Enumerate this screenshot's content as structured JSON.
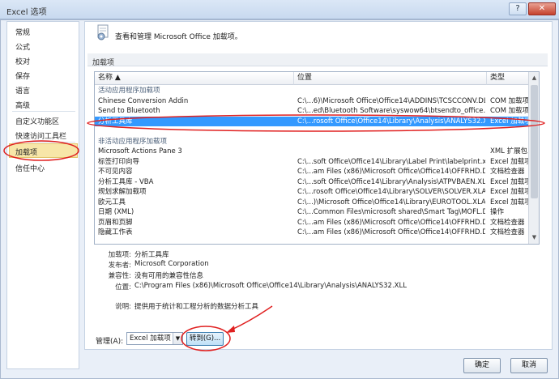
{
  "window": {
    "title": "Excel 选项",
    "help_label": "?",
    "close_label": "✕"
  },
  "sidebar": {
    "items": [
      {
        "label": "常规"
      },
      {
        "label": "公式"
      },
      {
        "label": "校对"
      },
      {
        "label": "保存"
      },
      {
        "label": "语言"
      },
      {
        "label": "高级"
      },
      {
        "label": "自定义功能区"
      },
      {
        "label": "快速访问工具栏"
      },
      {
        "label": "加载项"
      },
      {
        "label": "信任中心"
      }
    ],
    "active_index": 8
  },
  "header": {
    "icon": "gear-icon",
    "text": "查看和管理 Microsoft Office 加载项。"
  },
  "addins": {
    "section_title": "加载项",
    "columns": {
      "name": "名称 ▲",
      "location": "位置",
      "type": "类型"
    },
    "rows": [
      {
        "kind": "group",
        "name": "活动应用程序加载项",
        "location": "",
        "type": ""
      },
      {
        "kind": "item",
        "name": "Chinese Conversion Addin",
        "location": "C:\\...6)\\Microsoft Office\\Office14\\ADDINS\\TCSCCONV.DLL",
        "type": "COM 加载项"
      },
      {
        "kind": "item",
        "name": "Send to Bluetooth",
        "location": "C:\\...ed\\Bluetooth Software\\syswow64\\btsendto_office.dll",
        "type": "COM 加载项"
      },
      {
        "kind": "selected",
        "name": "分析工具库",
        "location": "C:\\...rosoft Office\\Office14\\Library\\Analysis\\ANALYS32.XLL",
        "type": "Excel 加载项"
      },
      {
        "kind": "item",
        "name": "",
        "location": "",
        "type": ""
      },
      {
        "kind": "group",
        "name": "非活动应用程序加载项",
        "location": "",
        "type": ""
      },
      {
        "kind": "item",
        "name": "Microsoft Actions Pane 3",
        "location": "",
        "type": "XML 扩展包"
      },
      {
        "kind": "item",
        "name": "标签打印向导",
        "location": "C:\\...soft Office\\Office14\\Library\\Label Print\\labelprint.xlam",
        "type": "Excel 加载项"
      },
      {
        "kind": "item",
        "name": "不可见内容",
        "location": "C:\\...am Files (x86)\\Microsoft Office\\Office14\\OFFRHD.DLL",
        "type": "文档检查器"
      },
      {
        "kind": "item",
        "name": "分析工具库 - VBA",
        "location": "C:\\...soft Office\\Office14\\Library\\Analysis\\ATPVBAEN.XLAM",
        "type": "Excel 加载项"
      },
      {
        "kind": "item",
        "name": "规划求解加载项",
        "location": "C:\\...rosoft Office\\Office14\\Library\\SOLVER\\SOLVER.XLAM",
        "type": "Excel 加载项"
      },
      {
        "kind": "item",
        "name": "欧元工具",
        "location": "C:\\...)\\Microsoft Office\\Office14\\Library\\EUROTOOL.XLAM",
        "type": "Excel 加载项"
      },
      {
        "kind": "item",
        "name": "日期 (XML)",
        "location": "C:\\...Common Files\\microsoft shared\\Smart Tag\\MOFL.DLL",
        "type": "操作"
      },
      {
        "kind": "item",
        "name": "页眉和页脚",
        "location": "C:\\...am Files (x86)\\Microsoft Office\\Office14\\OFFRHD.DLL",
        "type": "文档检查器"
      },
      {
        "kind": "item",
        "name": "隐藏工作表",
        "location": "C:\\...am Files (x86)\\Microsoft Office\\Office14\\OFFRHD.DLL",
        "type": "文档检查器"
      }
    ]
  },
  "details": {
    "addin": {
      "label": "加载项:",
      "value": "分析工具库"
    },
    "publisher": {
      "label": "发布者:",
      "value": "Microsoft Corporation"
    },
    "compat": {
      "label": "兼容性:",
      "value": "没有可用的兼容性信息"
    },
    "location": {
      "label": "位置:",
      "value": "C:\\Program Files (x86)\\Microsoft Office\\Office14\\Library\\Analysis\\ANALYS32.XLL"
    },
    "description": {
      "label": "说明:",
      "value": "提供用于统计和工程分析的数据分析工具"
    }
  },
  "manage": {
    "label": "管理(A):",
    "selected": "Excel 加载项",
    "go_label": "转到(G)..."
  },
  "footer": {
    "ok_label": "确定",
    "cancel_label": "取消"
  },
  "colors": {
    "selection": "#3399ff",
    "annotation": "#e02020",
    "active_nav": "#f7e6a8"
  }
}
